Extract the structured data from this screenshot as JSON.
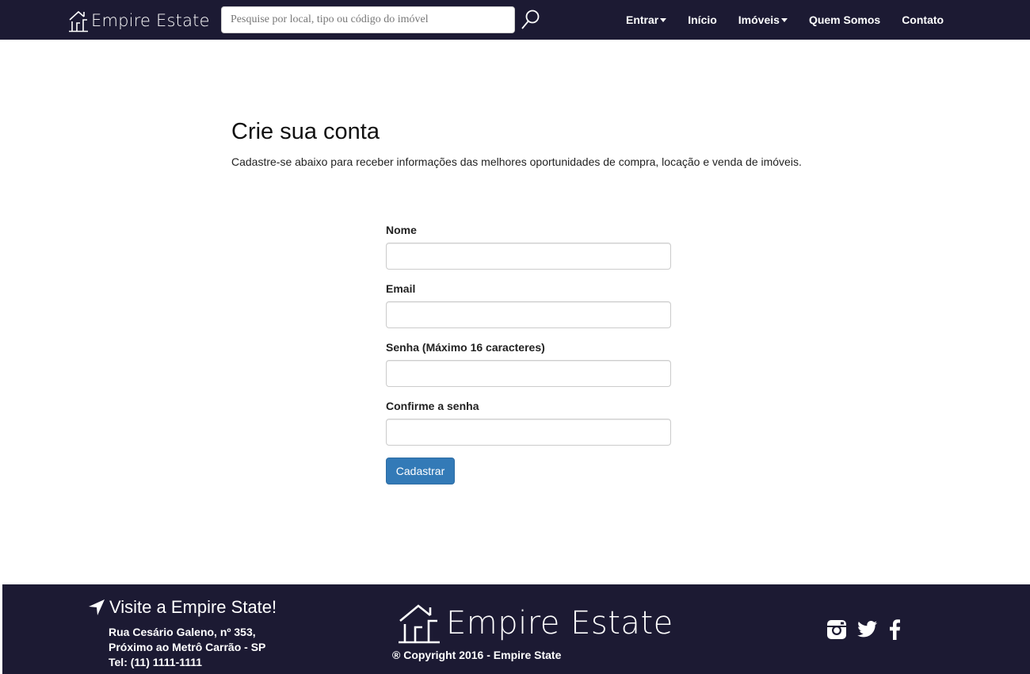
{
  "navbar": {
    "brand": "Empire Estate",
    "search_placeholder": "Pesquise por local, tipo ou código do imóvel",
    "items": [
      {
        "label": "Entrar",
        "dropdown": true
      },
      {
        "label": "Início",
        "dropdown": false
      },
      {
        "label": "Imóveis",
        "dropdown": true
      },
      {
        "label": "Quem Somos",
        "dropdown": false
      },
      {
        "label": "Contato",
        "dropdown": false
      }
    ]
  },
  "main": {
    "title": "Crie sua conta",
    "subtitle": "Cadastre-se abaixo para receber informações das melhores oportunidades de compra, locação e venda de imóveis.",
    "form": {
      "fields": [
        {
          "label": "Nome",
          "value": ""
        },
        {
          "label": "Email",
          "value": ""
        },
        {
          "label": "Senha (Máximo 16 caracteres)",
          "value": ""
        },
        {
          "label": "Confirme a senha",
          "value": ""
        }
      ],
      "submit_label": "Cadastrar"
    }
  },
  "footer": {
    "visit_title": "Visite a Empire State!",
    "address_line1": "Rua Cesário Galeno, nº 353,",
    "address_line2": "Próximo ao Metrô Carrão - SP",
    "phone": "Tel: (11) 1111-1111",
    "brand": "Empire Estate",
    "copyright": "® Copyright 2016 - Empire State",
    "social_icons": [
      "instagram-icon",
      "twitter-icon",
      "facebook-icon"
    ]
  },
  "colors": {
    "navbar_bg": "#1c1a33",
    "button_primary": "#337ab7",
    "text_white": "#ffffff"
  }
}
